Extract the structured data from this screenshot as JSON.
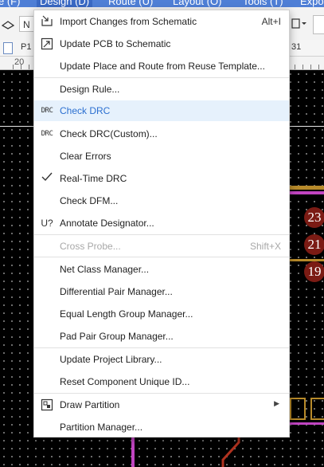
{
  "menubar": {
    "items": [
      "e (F)",
      "Design (D)",
      "Route (U)",
      "Layout (O)",
      "Tools (T)",
      "Expo"
    ]
  },
  "toolbar": {
    "select_value": "N"
  },
  "tabs": {
    "active_label": "P1",
    "right_label": "31"
  },
  "ruler": {
    "left_number": "20"
  },
  "pads": [
    "23",
    "21",
    "19"
  ],
  "menu": {
    "items": [
      {
        "label": "Import Changes from Schematic",
        "shortcut": "Alt+I",
        "icon": "import-icon"
      },
      {
        "label": "Update PCB to Schematic",
        "icon": "update-pcb-icon"
      },
      {
        "label": "Update Place and Route from Reuse Template..."
      },
      {
        "label": "Design Rule..."
      },
      {
        "label": "Check DRC",
        "icon_text": "DRC",
        "highlight": true
      },
      {
        "label": "Check DRC(Custom)...",
        "icon_text": "DRC"
      },
      {
        "label": "Clear Errors"
      },
      {
        "label": "Real-Time DRC",
        "icon": "check-icon"
      },
      {
        "label": "Check DFM..."
      },
      {
        "label": "Annotate Designator...",
        "icon_text": "U?"
      },
      {
        "label": "Cross Probe...",
        "shortcut": "Shift+X",
        "disabled": true
      },
      {
        "label": "Net Class Manager..."
      },
      {
        "label": "Differential Pair Manager..."
      },
      {
        "label": "Equal Length Group Manager..."
      },
      {
        "label": "Pad Pair Group Manager..."
      },
      {
        "label": "Update Project Library..."
      },
      {
        "label": "Reset Component Unique ID..."
      },
      {
        "label": "Draw Partition",
        "icon": "partition-icon",
        "submenu": true
      },
      {
        "label": "Partition Manager..."
      }
    ]
  }
}
